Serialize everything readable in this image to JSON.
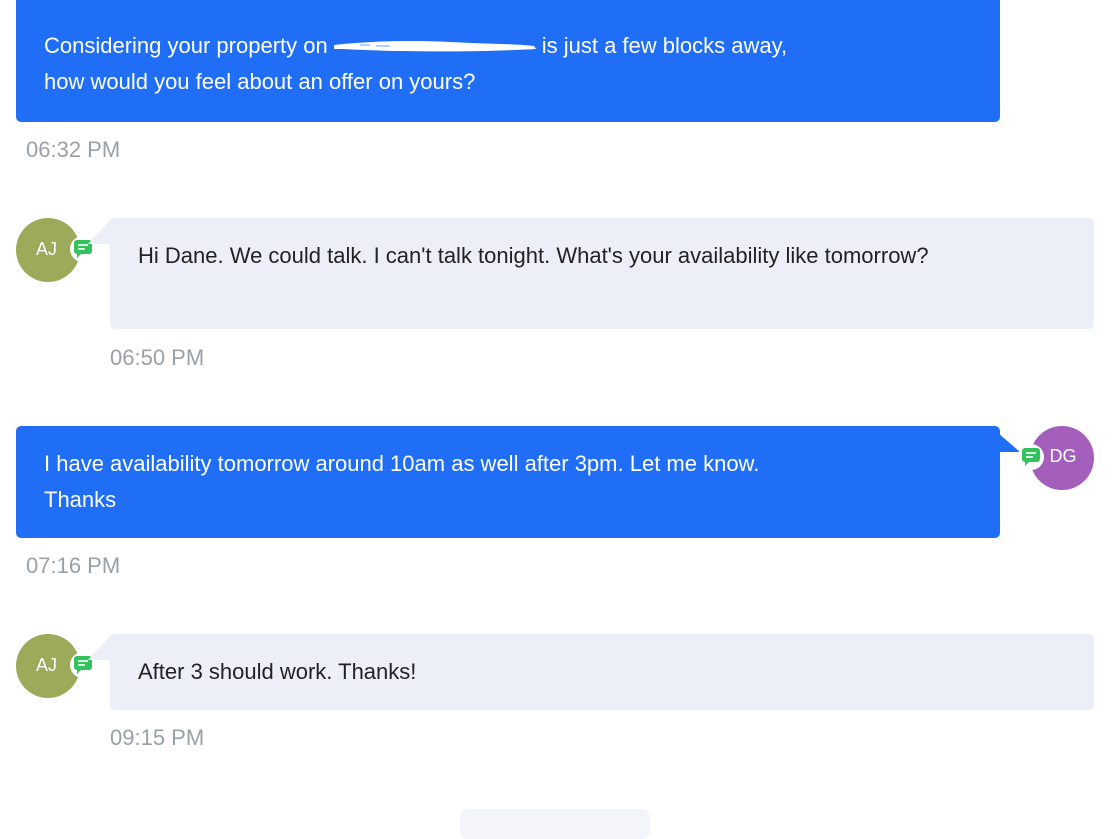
{
  "messages": [
    {
      "direction": "outgoing",
      "text_before_redaction": "Considering your property on",
      "text_after_redaction": "is just a few blocks away,",
      "text_line2": "how would you feel about an offer on yours?",
      "time": "06:32 PM"
    },
    {
      "direction": "incoming",
      "sender_initials": "AJ",
      "text": "Hi Dane. We could talk. I can't talk tonight. What's your availability like tomorrow?",
      "time": "06:50 PM"
    },
    {
      "direction": "outgoing",
      "sender_initials": "DG",
      "text_line1": "I have availability tomorrow around 10am as well after 3pm. Let me know.",
      "text_line2": "Thanks",
      "time": "07:16 PM"
    },
    {
      "direction": "incoming",
      "sender_initials": "AJ",
      "text": "After 3 should work. Thanks!",
      "time": "09:15 PM"
    }
  ],
  "icons": {
    "channel": "sms-chat-icon"
  },
  "colors": {
    "outgoing_bubble": "#1f6ef5",
    "incoming_bubble": "#eceff8",
    "avatar_aj": "#9caa5a",
    "avatar_dg": "#a35fbb",
    "sms_badge": "#33c25e",
    "timestamp": "#9aa0a8"
  }
}
